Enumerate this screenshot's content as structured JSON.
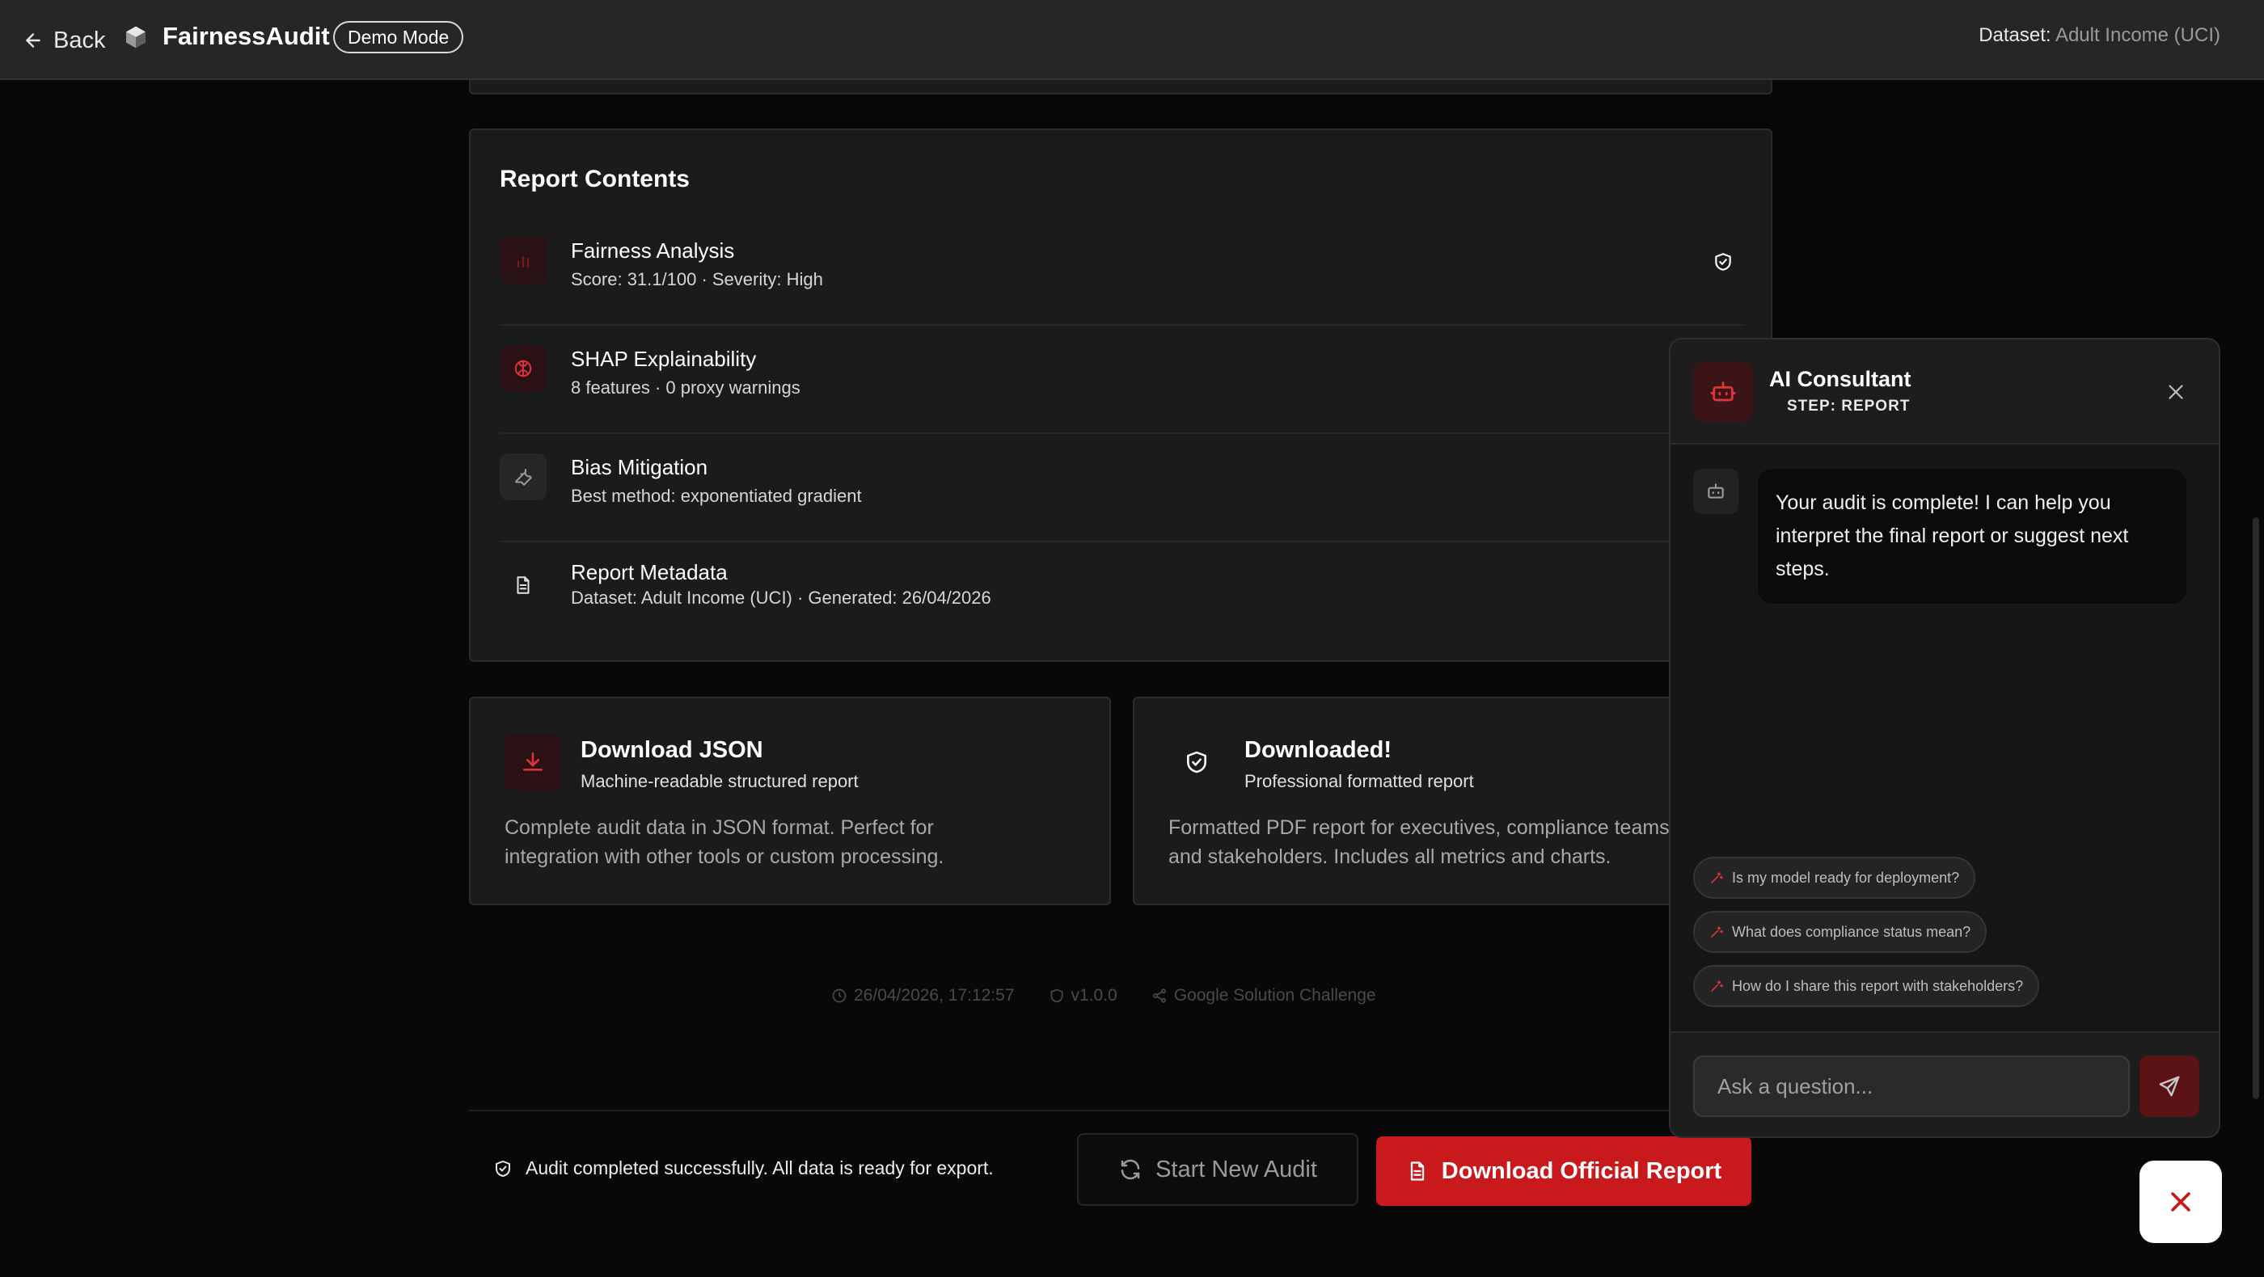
{
  "topbar": {
    "back_label": "Back",
    "brand": "FairnessAudit",
    "mode_badge": "Demo Mode",
    "dataset_label": "Dataset:",
    "dataset_value": "Adult Income (UCI)"
  },
  "report": {
    "title": "Report Contents",
    "items": [
      {
        "title": "Fairness Analysis",
        "subtitle": "Score: 31.1/100 · Severity: High",
        "icon": "bar-chart-icon"
      },
      {
        "title": "SHAP Explainability",
        "subtitle": "8 features · 0 proxy warnings",
        "icon": "brain-icon"
      },
      {
        "title": "Bias Mitigation",
        "subtitle": "Best method: exponentiated gradient",
        "icon": "wrench-icon"
      },
      {
        "title": "Report Metadata",
        "subtitle": "Dataset: Adult Income (UCI) · Generated: 26/04/2026",
        "icon": "document-icon"
      }
    ]
  },
  "downloads": {
    "json": {
      "title": "Download JSON",
      "subtitle": "Machine-readable structured report",
      "desc_line1": "Complete audit data in JSON format. Perfect for",
      "desc_line2": "integration with other tools or custom processing."
    },
    "pdf": {
      "title": "Downloaded!",
      "subtitle": "Professional formatted report",
      "desc_line1": "Formatted PDF report for executives, compliance teams,",
      "desc_line2": "and stakeholders. Includes all metrics and charts."
    }
  },
  "footer": {
    "timestamp": "26/04/2026, 17:12:57",
    "version": "v1.0.0",
    "event": "Google Solution Challenge"
  },
  "actions": {
    "status": "Audit completed successfully. All data is ready for export.",
    "new_audit": "Start New Audit",
    "download_report": "Download Official Report"
  },
  "chat": {
    "title": "AI Consultant",
    "step": "STEP: REPORT",
    "message": "Your audit is complete! I can help you interpret the final report or suggest next steps.",
    "suggestions": [
      "Is my model ready for deployment?",
      "What does compliance status mean?",
      "How do I share this report with stakeholders?"
    ],
    "input_placeholder": "Ask a question..."
  },
  "colors": {
    "accent": "#c8191d",
    "background": "#080808",
    "card": "#1b1b1b"
  }
}
